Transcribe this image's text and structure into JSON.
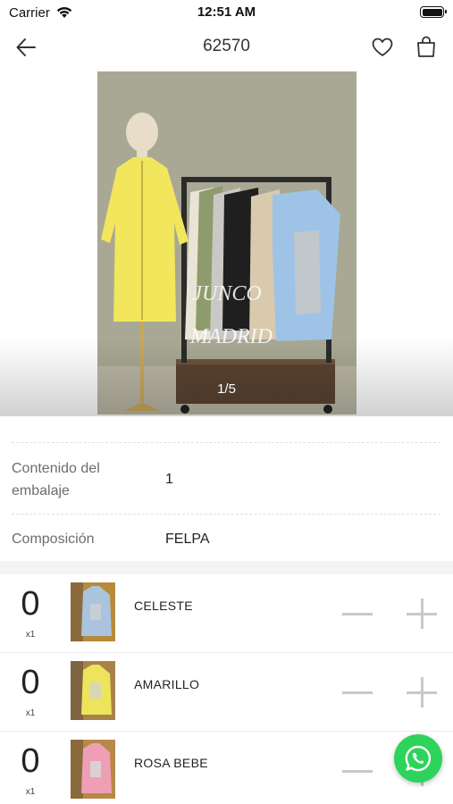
{
  "status_bar": {
    "carrier": "Carrier",
    "time": "12:51 AM",
    "wifi_icon": "wifi-icon",
    "battery_icon": "battery-icon"
  },
  "nav": {
    "title": "62570",
    "back_icon": "arrow-left-icon",
    "favorite_icon": "heart-icon",
    "cart_icon": "shopping-bag-icon"
  },
  "gallery": {
    "page_indicator": "1/5",
    "watermark_line1": "JUNCO",
    "watermark_line2": "MADRID"
  },
  "specs": [
    {
      "label": "Contenido del embalaje",
      "value": "1"
    },
    {
      "label": "Composición",
      "value": "FELPA"
    }
  ],
  "variants": [
    {
      "name": "CELESTE",
      "quantity": "0",
      "multiplier": "x1",
      "color": "#a9c4dc"
    },
    {
      "name": "AMARILLO",
      "quantity": "0",
      "multiplier": "x1",
      "color": "#ede45c"
    },
    {
      "name": "ROSA BEBE",
      "quantity": "0",
      "multiplier": "x1",
      "color": "#ef9fb3"
    }
  ],
  "whatsapp": {
    "icon": "whatsapp-icon",
    "color": "#2dd35a"
  },
  "colors": {
    "accent_green": "#2dd35a",
    "control_gray": "#c8c8c8"
  }
}
